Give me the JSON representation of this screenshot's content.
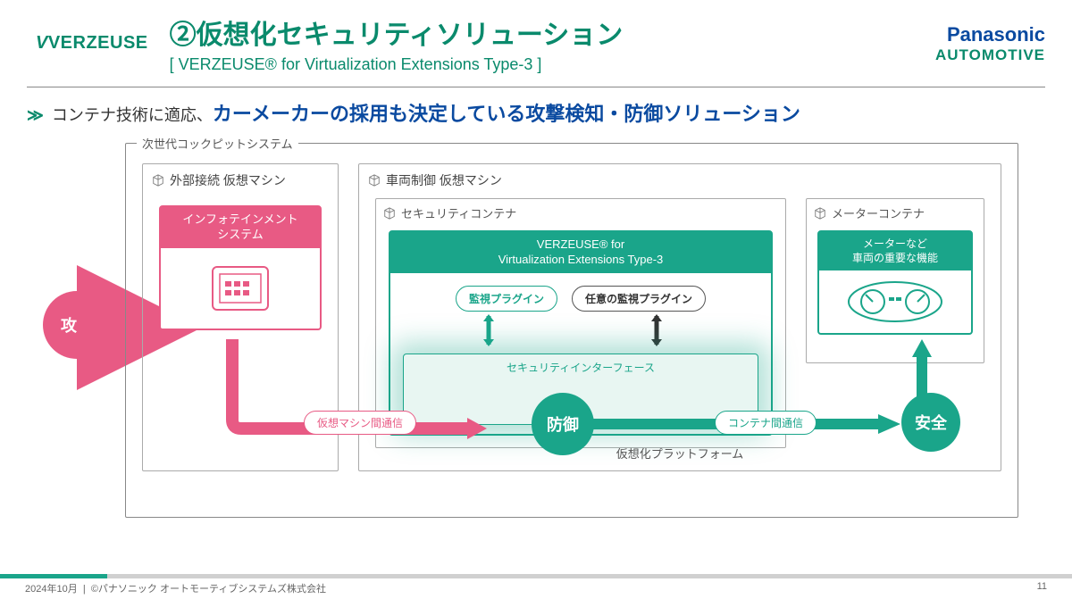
{
  "logo": "VERZEUSE",
  "title": "②仮想化セキュリティソリューション",
  "subtitle": "[ VERZEUSE® for Virtualization Extensions Type-3 ]",
  "brand": {
    "top": "Panasonic",
    "bottom": "AUTOMOTIVE"
  },
  "lead": {
    "chev": "≫",
    "pre": "コンテナ技術に適応、",
    "em": "カーメーカーの採用も決定している攻撃検知・防御ソリューション"
  },
  "nextgen_label": "次世代コックピットシステム",
  "vm_ext": {
    "title": "外部接続 仮想マシン",
    "info_head": "インフォテインメント\nシステム"
  },
  "vm_ctrl": {
    "title": "車両制御 仮想マシン"
  },
  "sec_container": {
    "title": "セキュリティコンテナ"
  },
  "verzeuse_box_head": "VERZEUSE® for\nVirtualization Extensions Type-3",
  "plugin1": "監視プラグイン",
  "plugin2": "任意の監視プラグイン",
  "sif_label": "セキュリティインターフェース",
  "meter_container": {
    "title": "メーターコンテナ"
  },
  "meter_head": "メーターなど\n車両の重要な機能",
  "platform_label": "仮想化プラットフォーム",
  "circles": {
    "attack": "攻撃",
    "defense": "防御",
    "safe": "安全"
  },
  "pills": {
    "vm": "仮想マシン間通信",
    "ct": "コンテナ間通信"
  },
  "footer": {
    "date": "2024年10月",
    "copy": "©パナソニック オートモーティブシステムズ株式会社",
    "page": "11"
  }
}
